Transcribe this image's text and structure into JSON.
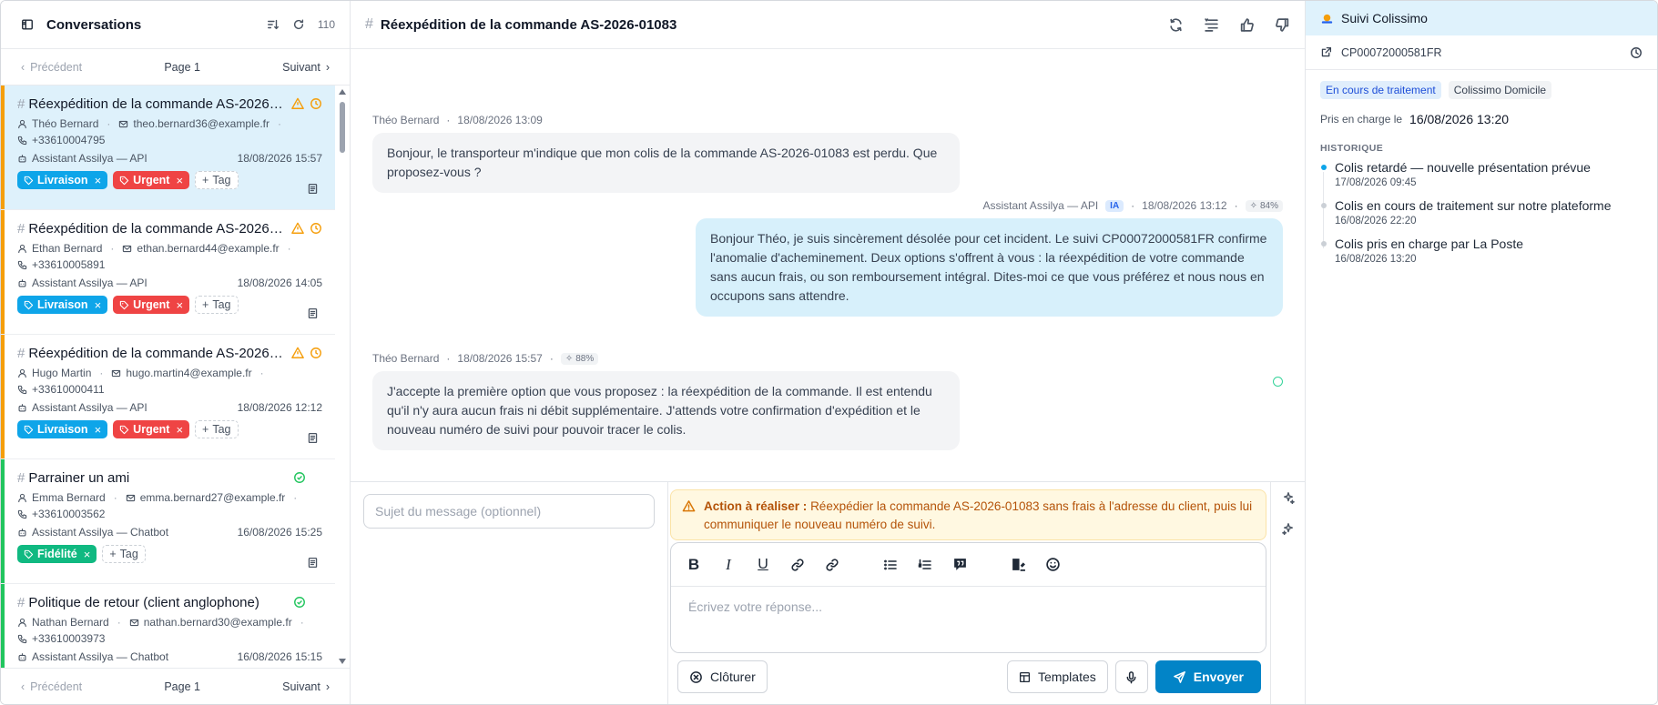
{
  "sidebar": {
    "title": "Conversations",
    "count": "110",
    "pager": {
      "prev": "Précédent",
      "page": "Page 1",
      "next": "Suivant"
    },
    "conversations": [
      {
        "title": "Réexpédition de la commande AS-2026-01083",
        "name": "Théo Bernard",
        "email": "theo.bernard36@example.fr",
        "phone": "+33610004795",
        "agent": "Assistant Assilya — API",
        "date": "18/08/2026 15:57",
        "tags": [
          "Livraison",
          "Urgent"
        ],
        "add_tag": "Tag",
        "status": "warning",
        "bar_color": "#f59e0b"
      },
      {
        "title": "Réexpédition de la commande AS-2026-01083",
        "name": "Ethan Bernard",
        "email": "ethan.bernard44@example.fr",
        "phone": "+33610005891",
        "agent": "Assistant Assilya — API",
        "date": "18/08/2026 14:05",
        "tags": [
          "Livraison",
          "Urgent"
        ],
        "add_tag": "Tag",
        "status": "warning",
        "bar_color": "#f59e0b"
      },
      {
        "title": "Réexpédition de la commande AS-2026-01083",
        "name": "Hugo Martin",
        "email": "hugo.martin4@example.fr",
        "phone": "+33610000411",
        "agent": "Assistant Assilya — API",
        "date": "18/08/2026 12:12",
        "tags": [
          "Livraison",
          "Urgent"
        ],
        "add_tag": "Tag",
        "status": "warning",
        "bar_color": "#f59e0b"
      },
      {
        "title": "Parrainer un ami",
        "name": "Emma Bernard",
        "email": "emma.bernard27@example.fr",
        "phone": "+33610003562",
        "agent": "Assistant Assilya — Chatbot",
        "date": "16/08/2026 15:25",
        "tags": [
          "Fidélité"
        ],
        "add_tag": "Tag",
        "status": "resolved",
        "bar_color": "#22c55e"
      },
      {
        "title": "Politique de retour (client anglophone)",
        "name": "Nathan Bernard",
        "email": "nathan.bernard30@example.fr",
        "phone": "+33610003973",
        "agent": "Assistant Assilya — Chatbot",
        "date": "16/08/2026 15:15",
        "tags": [],
        "add_tag": "Tag",
        "status": "resolved",
        "bar_color": "#22c55e"
      }
    ]
  },
  "conversation": {
    "title": "Réexpédition de la commande AS-2026-01083",
    "messages": [
      {
        "author": "Théo Bernard",
        "date": "18/08/2026 13:09",
        "text": "Bonjour, le transporteur m'indique que mon colis de la commande AS-2026-01083 est perdu. Que proposez-vous ?"
      },
      {
        "author": "Assistant Assilya — API",
        "ia_badge": "IA",
        "date": "18/08/2026 13:12",
        "confidence": "84%",
        "text": "Bonjour Théo, je suis sincèrement désolée pour cet incident. Le suivi CP00072000581FR confirme l'anomalie d'acheminement. Deux options s'offrent à vous : la réexpédition de votre commande sans aucun frais, ou son remboursement intégral. Dites-moi ce que vous préférez et nous nous en occupons sans attendre."
      },
      {
        "author": "Théo Bernard",
        "date": "18/08/2026 15:57",
        "confidence": "88%",
        "text": "J'accepte la première option que vous proposez : la réexpédition de la commande. Il est entendu qu'il n'y aura aucun frais ni débit supplémentaire. J'attends votre confirmation d'expédition et le nouveau numéro de suivi pour pouvoir tracer le colis."
      }
    ]
  },
  "composer": {
    "subject_placeholder": "Sujet du message (optionnel)",
    "action_label": "Action à réaliser :",
    "action_text": "Réexpédier la commande AS-2026-01083 sans frais à l'adresse du client, puis lui communiquer le nouveau numéro de suivi.",
    "reply_placeholder": "Écrivez votre réponse...",
    "close_label": "Clôturer",
    "templates_label": "Templates",
    "send_label": "Envoyer"
  },
  "tracking": {
    "title": "Suivi Colissimo",
    "number": "CP00072000581FR",
    "chips": [
      "En cours de traitement",
      "Colissimo Domicile"
    ],
    "taken_label": "Pris en charge le",
    "taken_value": "16/08/2026 13:20",
    "history_label": "HISTORIQUE",
    "events": [
      {
        "text": "Colis retardé — nouvelle présentation prévue",
        "date": "17/08/2026 09:45"
      },
      {
        "text": "Colis en cours de traitement sur notre plateforme",
        "date": "16/08/2026 22:20"
      },
      {
        "text": "Colis pris en charge par La Poste",
        "date": "16/08/2026 13:20"
      }
    ]
  },
  "colors": {
    "accent": "#0284c7",
    "warning": "#f59e0b",
    "success": "#22c55e",
    "urgent": "#ef4444",
    "livraison": "#0ea5e9",
    "fidelite": "#10b981"
  }
}
